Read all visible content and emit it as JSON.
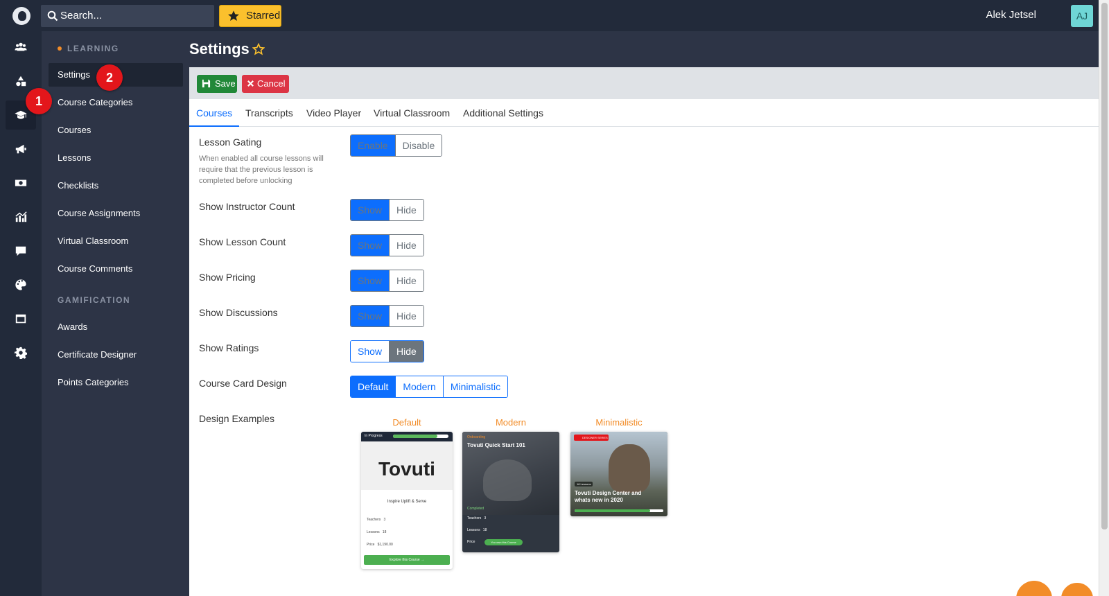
{
  "topbar": {
    "search_placeholder": "Search...",
    "starred_label": "Starred",
    "user_name": "Alek Jetsel",
    "avatar_initials": "AJ"
  },
  "rail": {
    "icons": [
      "users-icon",
      "shapes-icon",
      "graduation-cap-icon",
      "megaphone-icon",
      "money-icon",
      "chart-icon",
      "comment-icon",
      "palette-icon",
      "window-icon",
      "gear-icon"
    ],
    "active_index": 2
  },
  "subnav": {
    "learning_title": "LEARNING",
    "learning_items": [
      "Settings",
      "Course Categories",
      "Courses",
      "Lessons",
      "Checklists",
      "Course Assignments",
      "Virtual Classroom",
      "Course Comments"
    ],
    "gamification_title": "GAMIFICATION",
    "gamification_items": [
      "Awards",
      "Certificate Designer",
      "Points Categories"
    ]
  },
  "badges": [
    "1",
    "2"
  ],
  "page": {
    "title": "Settings"
  },
  "toolbar": {
    "save_label": "Save",
    "cancel_label": "Cancel"
  },
  "tabs": [
    "Courses",
    "Transcripts",
    "Video Player",
    "Virtual Classroom",
    "Additional Settings"
  ],
  "settings": {
    "lesson_gating": {
      "label": "Lesson Gating",
      "description": "When enabled all course lessons will require that the previous lesson is completed before unlocking",
      "options": [
        "Enable",
        "Disable"
      ],
      "selected": "Enable"
    },
    "instructor_count": {
      "label": "Show Instructor Count",
      "options": [
        "Show",
        "Hide"
      ],
      "selected": "Show"
    },
    "lesson_count": {
      "label": "Show Lesson Count",
      "options": [
        "Show",
        "Hide"
      ],
      "selected": "Show"
    },
    "pricing": {
      "label": "Show Pricing",
      "options": [
        "Show",
        "Hide"
      ],
      "selected": "Show"
    },
    "discussions": {
      "label": "Show Discussions",
      "options": [
        "Show",
        "Hide"
      ],
      "selected": "Show"
    },
    "ratings": {
      "label": "Show Ratings",
      "options": [
        "Show",
        "Hide"
      ],
      "selected": "Hide"
    },
    "card_design": {
      "label": "Course Card Design",
      "options": [
        "Default",
        "Modern",
        "Minimalistic"
      ],
      "selected": "Default"
    },
    "design_examples_label": "Design Examples"
  },
  "examples": {
    "default_head": "Default",
    "modern_head": "Modern",
    "minimal_head": "Minimalistic",
    "default_card": {
      "status": "In Progress",
      "logo": "Tovuti",
      "tagline": "Inspire Uplift & Serve",
      "teachers": "Teachers",
      "teachers_count": "3",
      "lessons": "Lessons",
      "lessons_count": "18",
      "price": "Price",
      "price_value": "$1,190.00",
      "cta": "Explore this Course →"
    },
    "modern_card": {
      "tag": "Onboarding",
      "title": "Tovuti Quick Start 101",
      "completed": "Completed",
      "teachers": "Teachers",
      "teachers_count": "3",
      "lessons": "Lessons",
      "lessons_count": "18",
      "price": "Price",
      "price_value": "You own this Course"
    },
    "minimal_card": {
      "tag": "DESIGNER SERIES",
      "lessons": "18 Lessons",
      "title": "Tovuti Design Center and whats new in 2020"
    }
  },
  "colors": {
    "primary": "#0d6efd",
    "save": "#218838",
    "cancel": "#dc3545",
    "accent": "#f28c28",
    "starred": "#fbc02d"
  }
}
